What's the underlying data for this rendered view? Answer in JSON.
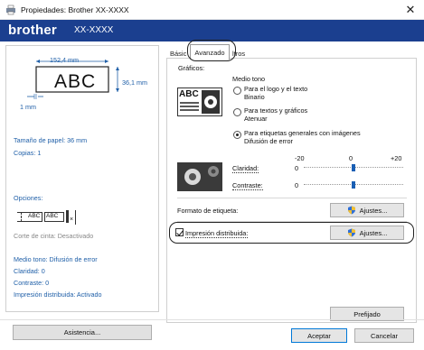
{
  "window": {
    "title": "Propiedades: Brother XX-XXXX",
    "close_icon": "close-icon",
    "app_icon": "printer-icon"
  },
  "banner": {
    "brand": "brother",
    "model": "XX-XXXX",
    "background": "#1b3f8f"
  },
  "left": {
    "preview": {
      "width_label": "152,4 mm",
      "height_label": "36,1 mm",
      "margin_label": "1 mm",
      "label_text": "ABC"
    },
    "summary": {
      "paper_size": "Tamaño de papel: 36 mm",
      "copies": "Copias: 1",
      "options_title": "Opciones:",
      "opt_labels": [
        "ABC",
        "ABC"
      ],
      "cut": "Corte de cinta: Desactivado",
      "halftone": "Medio tono: Difusión de error",
      "brightness": "Claridad:  0",
      "contrast": "Contraste:  0",
      "distributed": "Impresión distribuida: Activado"
    },
    "assist_button": "Asistencia..."
  },
  "tabs": [
    "Básic",
    "Avanzado",
    "ltros"
  ],
  "right": {
    "graphics_label": "Gráficos:",
    "halftone_label": "Medio tono",
    "graphic_sample_text": "ABC",
    "options": [
      {
        "line1": "Para el logo y el texto",
        "line2": "Binario",
        "selected": false
      },
      {
        "line1": "Para textos y gráficos",
        "line2": "Atenuar",
        "selected": false
      },
      {
        "line1": "Para etiquetas generales con imágenes",
        "line2": "Difusión de error",
        "selected": true
      }
    ],
    "scale": {
      "min": "-20",
      "mid": "0",
      "max": "+20"
    },
    "brightness": {
      "label": "Claridad:",
      "value": "0",
      "level": 0
    },
    "contrast": {
      "label": "Contraste:",
      "value": "0",
      "level": 0
    },
    "label_format": "Formato de etiqueta:",
    "settings_button": "Ajustes...",
    "distributed": {
      "label": "Impresión distribuida:",
      "checked": true
    },
    "default_button": "Prefijado"
  },
  "footer": {
    "accept": "Aceptar",
    "cancel": "Cancelar"
  },
  "colors": {
    "accent": "#1f5fa8",
    "slider": "#1a5fb4"
  }
}
